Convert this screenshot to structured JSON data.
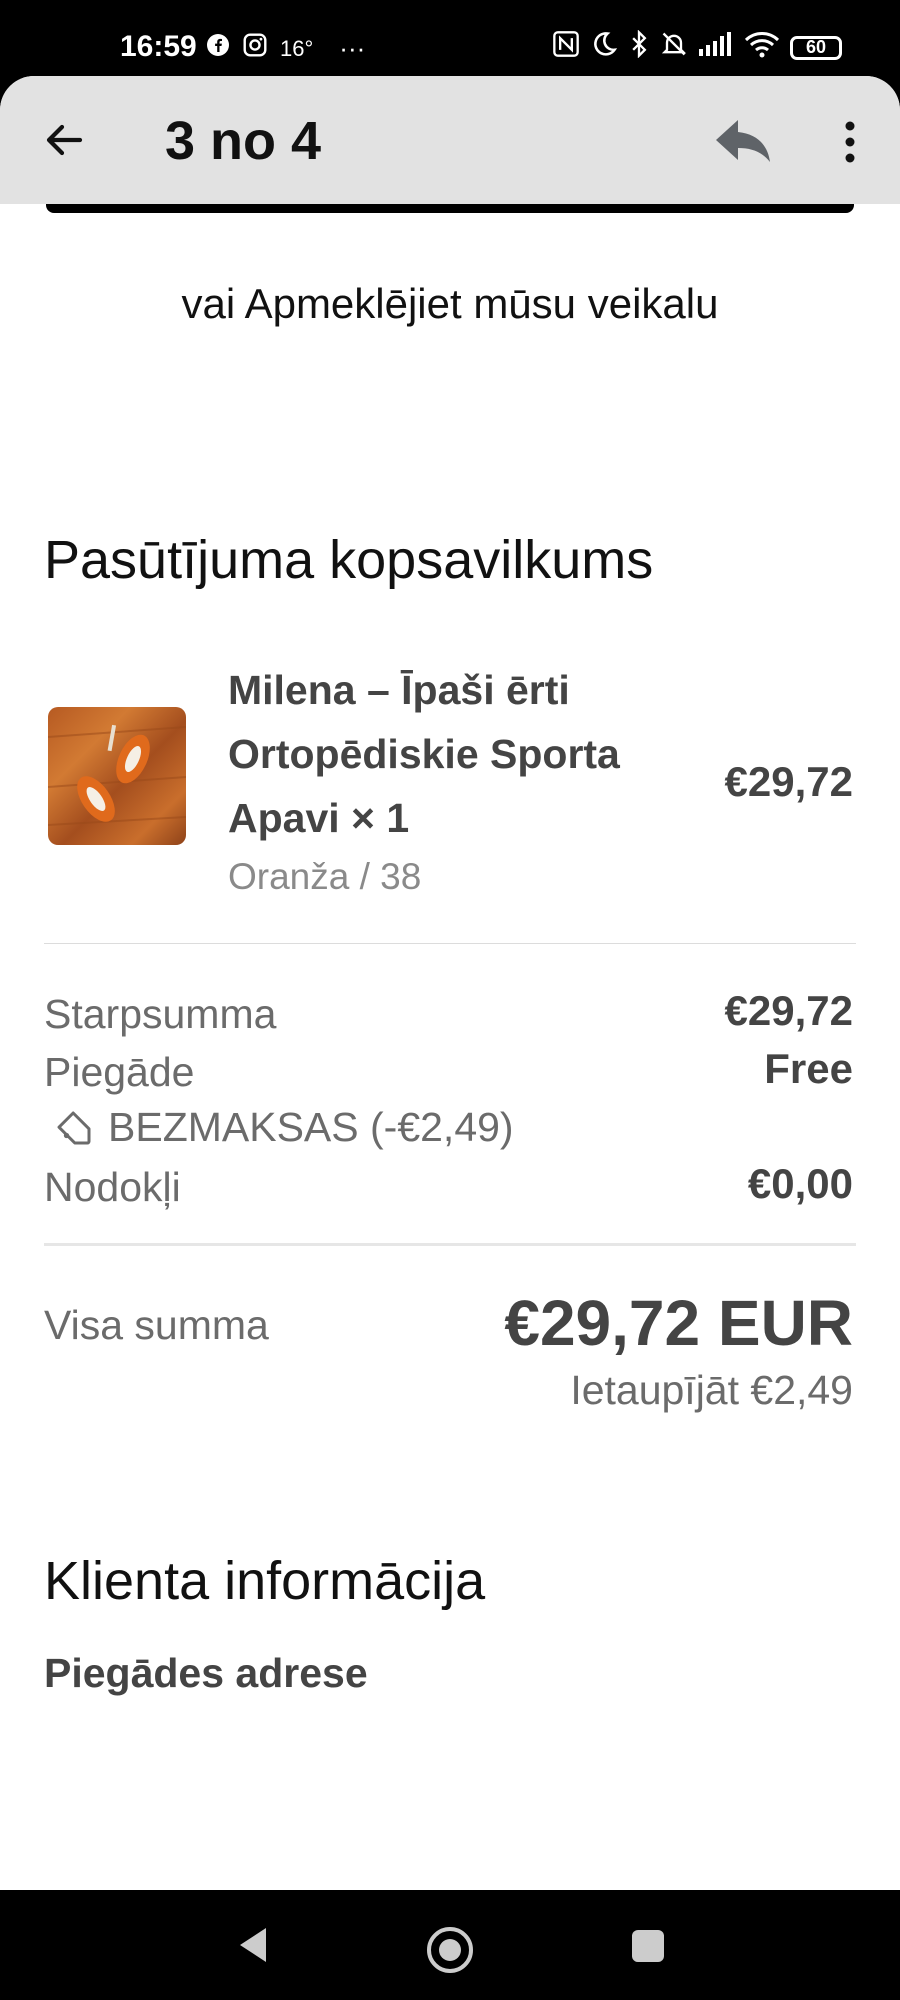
{
  "status_bar": {
    "time": "16:59",
    "temperature": "16°",
    "more_indicator": "···",
    "battery": "60"
  },
  "app_bar": {
    "title": "3 no 4"
  },
  "email": {
    "visit_store_link": "vai Apmeklējiet mūsu veikalu",
    "summary_heading": "Pasūtījuma kopsavilkums",
    "product": {
      "name": "Milena – Īpaši ērti Ortopēdiskie Sporta Apavi × 1",
      "variant": "Oranža / 38",
      "price": "€29,72"
    },
    "subtotal": {
      "label": "Starpsumma",
      "value": "€29,72"
    },
    "shipping": {
      "label": "Piegāde",
      "value": "Free"
    },
    "discount": {
      "label": "BEZMAKSAS (-€2,49)"
    },
    "taxes": {
      "label": "Nodokļi",
      "value": "€0,00"
    },
    "total": {
      "label": "Visa summa",
      "value": "€29,72 EUR"
    },
    "savings": "Ietaupījāt €2,49",
    "customer_heading": "Klienta informācija",
    "shipping_address_label": "Piegādes adrese"
  },
  "colors": {
    "app_bar_bg": "#e2e2e2",
    "text_dark": "#111111",
    "text_gray": "#6b6b6b",
    "product_image_tone": "#c06a2c"
  }
}
